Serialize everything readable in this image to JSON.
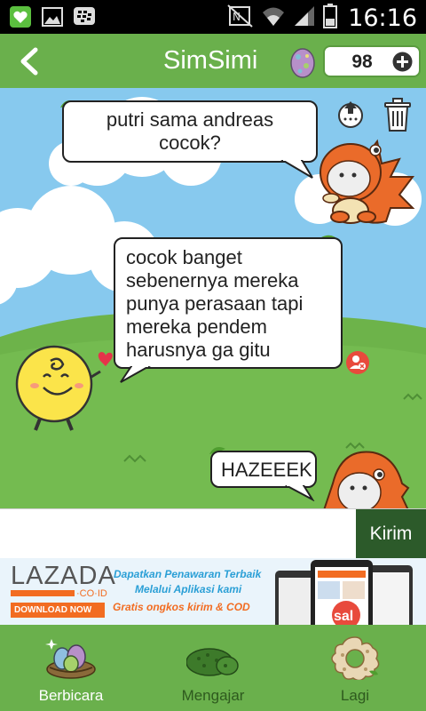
{
  "status_bar": {
    "time": "16:16",
    "left_icons": [
      "notification-heart-icon",
      "gallery-icon",
      "bbm-icon"
    ],
    "right_icons": [
      "nfc-icon",
      "wifi-icon",
      "signal-icon",
      "battery-icon"
    ]
  },
  "header": {
    "title": "SimSimi",
    "points": "98"
  },
  "chat": {
    "messages": [
      {
        "from": "user",
        "text_line1": "putri sama andreas",
        "text_line2": "cocok?"
      },
      {
        "from": "simsimi",
        "lines": [
          "cocok banget",
          "sebenernya mereka",
          "punya perasaan tapi",
          "mereka pendem",
          "harusnya ga gitu"
        ]
      },
      {
        "from": "user",
        "text": "HAZEEEK"
      }
    ]
  },
  "composer": {
    "input_value": "",
    "send_label": "Kirim"
  },
  "ad": {
    "brand": "LAZADA",
    "brand_suffix": "·CO·ID",
    "download_label": "DOWNLOAD NOW",
    "line1": "Dapatkan Penawaran Terbaik",
    "line2": "Melalui Aplikasi kami",
    "line3": "Gratis ongkos kirim & COD",
    "phone_text": "sal"
  },
  "bottom_nav": {
    "items": [
      {
        "label": "Berbicara",
        "active": true
      },
      {
        "label": "Mengajar",
        "active": false
      },
      {
        "label": "Lagi",
        "active": false
      }
    ]
  },
  "colors": {
    "header_green": "#6ab04c",
    "send_button": "#2c5a2a",
    "sky": "#87c9ee",
    "grass": "#6db34a",
    "dino_orange": "#ea6b2a",
    "ad_orange": "#f26c21"
  }
}
